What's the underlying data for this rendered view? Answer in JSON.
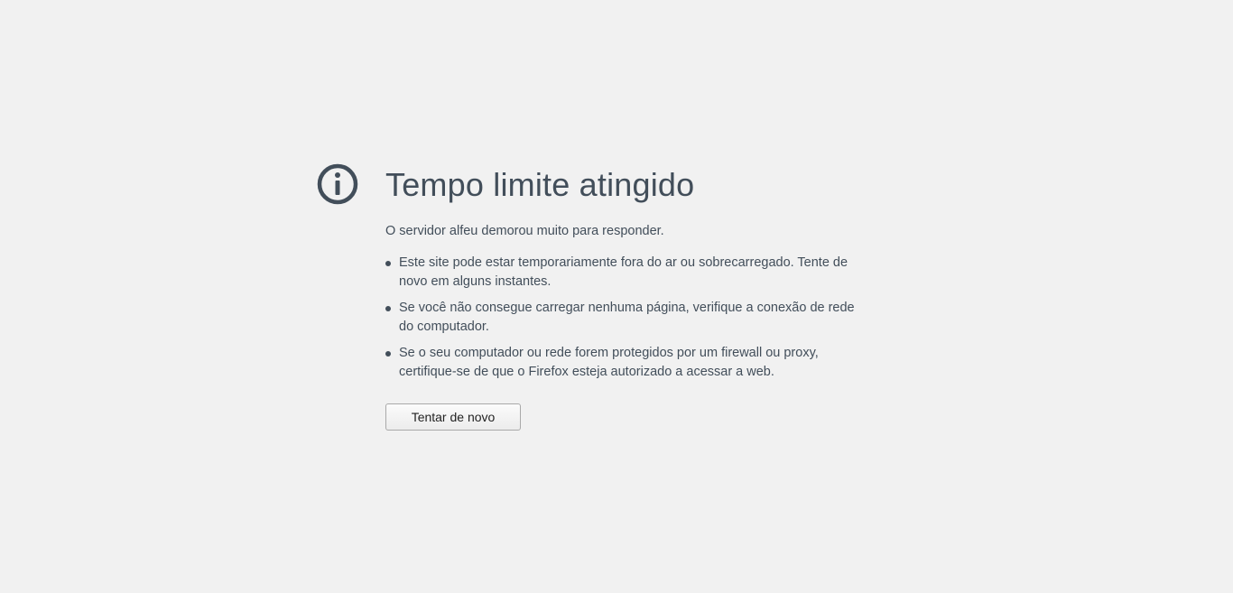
{
  "error": {
    "icon": "info-icon",
    "title": "Tempo limite atingido",
    "description": "O servidor alfeu demorou muito para responder.",
    "tips": [
      "Este site pode estar temporariamente fora do ar ou sobrecarregado. Tente de novo em alguns instantes.",
      "Se você não consegue carregar nenhuma página, verifique a conexão de rede do computador.",
      "Se o seu computador ou rede forem protegidos por um firewall ou proxy, certifique-se de que o Firefox esteja autorizado a acessar a web."
    ],
    "retry_label": "Tentar de novo"
  },
  "colors": {
    "background": "#f1f1f1",
    "text": "#424e5a",
    "icon": "#424e5a"
  }
}
